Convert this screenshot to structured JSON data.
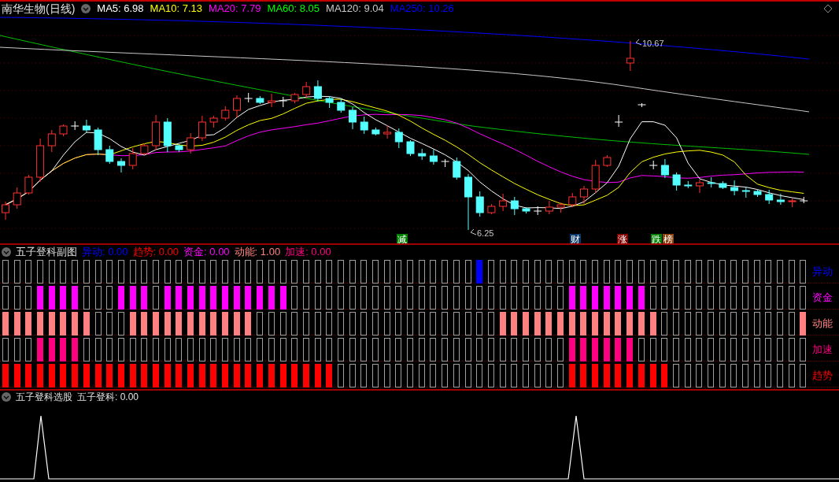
{
  "chart_header": {
    "title": "南华生物(日线)",
    "ma_legend": [
      {
        "text": "MA5: 6.98",
        "color": "#ffffff"
      },
      {
        "text": "MA10: 7.13",
        "color": "#ffff00"
      },
      {
        "text": "MA20: 7.79",
        "color": "#ff00ff"
      },
      {
        "text": "MA60: 8.05",
        "color": "#00ff00"
      },
      {
        "text": "MA120: 9.04",
        "color": "#c8c8c8"
      },
      {
        "text": "MA250: 10.26",
        "color": "#0000ff"
      }
    ]
  },
  "price_labels": [
    {
      "text": "10.67",
      "kind": "high"
    },
    {
      "text": "6.25",
      "kind": "low"
    }
  ],
  "event_markers": [
    {
      "text": "减",
      "color": "#008000"
    },
    {
      "text": "财",
      "color": "#0a3a6a"
    },
    {
      "text": "涨",
      "color": "#800000"
    },
    {
      "text": "跌",
      "color": "#008000"
    },
    {
      "text": "榜",
      "color": "#8b4513"
    }
  ],
  "signal_panel": {
    "title": "五子登科副图",
    "legend": [
      {
        "text": "异动: 0.00",
        "color": "#0000ff"
      },
      {
        "text": "趋势: 0.00",
        "color": "#ff0000"
      },
      {
        "text": "资金: 0.00",
        "color": "#ff00ff"
      },
      {
        "text": "动能: 1.00",
        "color": "#ff8080"
      },
      {
        "text": "加速: 0.00",
        "color": "#ff0080"
      }
    ],
    "rows": [
      {
        "label": "异动",
        "color": "#0000ff",
        "cells": [
          false,
          false,
          false,
          false,
          false,
          false,
          false,
          false,
          false,
          false,
          false,
          false,
          false,
          false,
          false,
          false,
          false,
          false,
          false,
          false,
          false,
          false,
          false,
          false,
          false,
          false,
          false,
          false,
          false,
          false,
          false,
          false,
          false,
          false,
          false,
          false,
          false,
          false,
          false,
          false,
          false,
          true,
          false,
          false,
          false,
          false,
          false,
          false,
          false,
          false,
          false,
          false,
          false,
          false,
          false,
          false,
          false,
          false,
          false,
          false,
          false,
          false,
          false,
          false,
          false,
          false,
          false,
          false,
          false,
          false
        ]
      },
      {
        "label": "资金",
        "color": "#ff00ff",
        "cells": [
          false,
          false,
          false,
          true,
          true,
          true,
          true,
          false,
          false,
          false,
          true,
          true,
          true,
          false,
          true,
          true,
          true,
          true,
          true,
          true,
          true,
          true,
          true,
          true,
          true,
          false,
          false,
          false,
          false,
          false,
          false,
          false,
          false,
          false,
          false,
          false,
          false,
          false,
          false,
          false,
          false,
          false,
          false,
          false,
          false,
          false,
          false,
          false,
          false,
          true,
          true,
          true,
          true,
          true,
          true,
          true,
          false,
          false,
          false,
          false,
          false,
          false,
          false,
          false,
          false,
          false,
          false,
          false,
          false,
          false
        ]
      },
      {
        "label": "动能",
        "color": "#ff8080",
        "cells": [
          true,
          true,
          true,
          true,
          true,
          true,
          true,
          true,
          false,
          false,
          false,
          true,
          true,
          true,
          true,
          true,
          true,
          true,
          true,
          true,
          true,
          true,
          false,
          false,
          false,
          false,
          false,
          false,
          false,
          false,
          false,
          false,
          false,
          false,
          false,
          false,
          false,
          false,
          false,
          false,
          false,
          false,
          false,
          true,
          true,
          true,
          true,
          true,
          true,
          true,
          true,
          true,
          true,
          true,
          true,
          true,
          true,
          false,
          false,
          false,
          false,
          false,
          false,
          false,
          false,
          false,
          false,
          false,
          false,
          true
        ]
      },
      {
        "label": "加速",
        "color": "#ff0080",
        "cells": [
          false,
          false,
          false,
          true,
          true,
          true,
          true,
          false,
          false,
          false,
          false,
          false,
          false,
          false,
          false,
          false,
          false,
          false,
          false,
          false,
          false,
          false,
          false,
          false,
          false,
          false,
          false,
          false,
          false,
          false,
          false,
          false,
          false,
          false,
          false,
          false,
          false,
          false,
          false,
          false,
          false,
          false,
          false,
          false,
          false,
          false,
          false,
          false,
          false,
          true,
          true,
          true,
          true,
          true,
          true,
          false,
          false,
          false,
          false,
          false,
          false,
          false,
          false,
          false,
          false,
          false,
          false,
          false,
          false,
          false
        ]
      },
      {
        "label": "趋势",
        "color": "#ff0000",
        "cells": [
          true,
          true,
          true,
          true,
          true,
          true,
          true,
          true,
          true,
          true,
          true,
          true,
          true,
          true,
          true,
          true,
          true,
          true,
          true,
          true,
          true,
          true,
          true,
          true,
          true,
          true,
          true,
          true,
          true,
          false,
          false,
          false,
          false,
          false,
          false,
          false,
          false,
          false,
          false,
          false,
          false,
          false,
          false,
          false,
          false,
          false,
          false,
          false,
          false,
          true,
          true,
          true,
          true,
          true,
          true,
          true,
          true,
          true,
          false,
          false,
          false,
          false,
          false,
          false,
          false,
          false,
          false,
          false,
          false,
          false
        ]
      }
    ]
  },
  "screener_panel": {
    "title": "五子登科选股",
    "legend": "五子登科: 0.00"
  }
}
